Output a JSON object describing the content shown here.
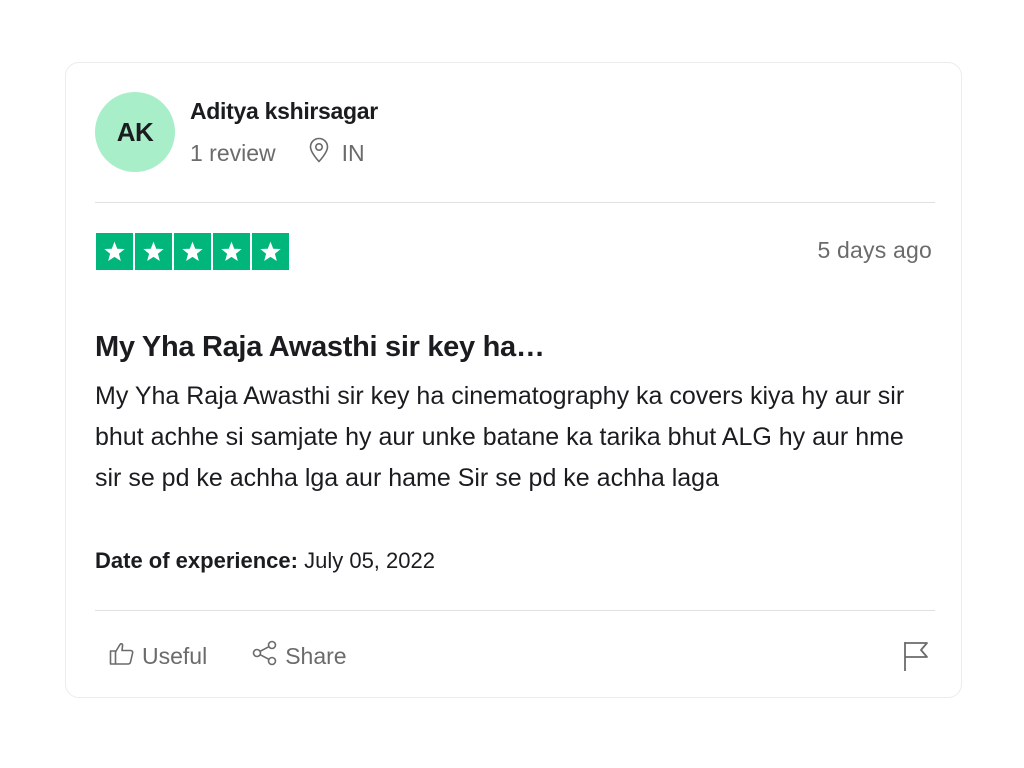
{
  "reviewer": {
    "initials": "AK",
    "avatar_color": "#a8eec9",
    "name": "Aditya kshirsagar",
    "review_count": "1 review",
    "location": "IN",
    "location_icon": "map-pin-icon"
  },
  "rating": {
    "stars": 5,
    "max_stars": 5,
    "star_color": "#00b67a",
    "posted": "5 days ago"
  },
  "review": {
    "title": "My Yha Raja Awasthi sir key ha…",
    "body": "My Yha Raja Awasthi sir key ha cinematography ka covers kiya hy aur sir bhut achhe si samjate hy aur unke batane ka tarika bhut ALG hy aur hme sir se pd ke achha lga aur hame Sir se pd ke achha laga",
    "experience_label": "Date of experience:",
    "experience_date": "July 05, 2022"
  },
  "actions": {
    "useful_label": "Useful",
    "useful_icon": "thumbs-up-icon",
    "share_label": "Share",
    "share_icon": "share-icon",
    "report_icon": "flag-icon"
  }
}
